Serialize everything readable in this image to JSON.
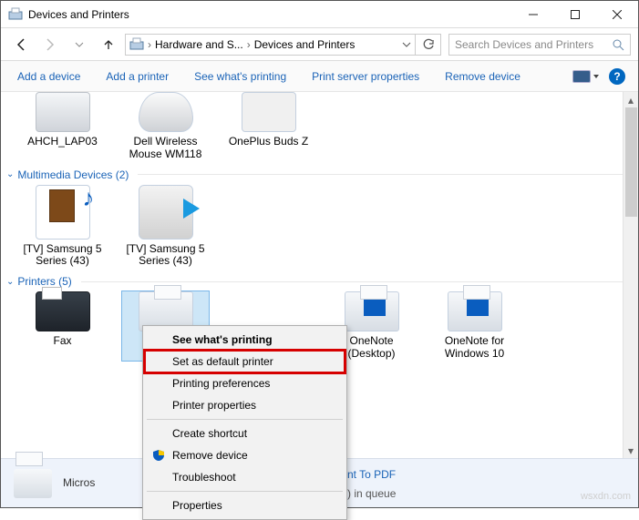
{
  "window": {
    "title": "Devices and Printers"
  },
  "nav": {
    "crumb1": "Hardware and S...",
    "crumb2": "Devices and Printers",
    "search_placeholder": "Search Devices and Printers"
  },
  "commands": {
    "add_device": "Add a device",
    "add_printer": "Add a printer",
    "see_printing": "See what's printing",
    "print_server_props": "Print server properties",
    "remove_device": "Remove device"
  },
  "groups": {
    "devices_partial": [
      {
        "name": "AHCH_LAP03"
      },
      {
        "name": "Dell Wireless Mouse WM118"
      },
      {
        "name": "OnePlus Buds Z"
      }
    ],
    "multimedia": {
      "header": "Multimedia Devices (2)",
      "items": [
        {
          "name": "[TV] Samsung 5 Series (43)"
        },
        {
          "name": "[TV] Samsung 5 Series (43)"
        }
      ]
    },
    "printers": {
      "header": "Printers (5)",
      "items": [
        {
          "name": "Fax"
        },
        {
          "name": "Micros"
        },
        {
          "name": "OneNote (Desktop)"
        },
        {
          "name": "OneNote for Windows 10"
        }
      ]
    }
  },
  "context_menu": {
    "see_printing": "See what's printing",
    "set_default": "Set as default printer",
    "printing_prefs": "Printing preferences",
    "printer_props": "Printer properties",
    "create_shortcut": "Create shortcut",
    "remove_device": "Remove device",
    "troubleshoot": "Troubleshoot",
    "properties": "Properties"
  },
  "status": {
    "selected_partial": "Micros",
    "link_text_frag": "nt To PDF",
    "queue_frag": ") in queue"
  },
  "watermark": "wsxdn.com"
}
